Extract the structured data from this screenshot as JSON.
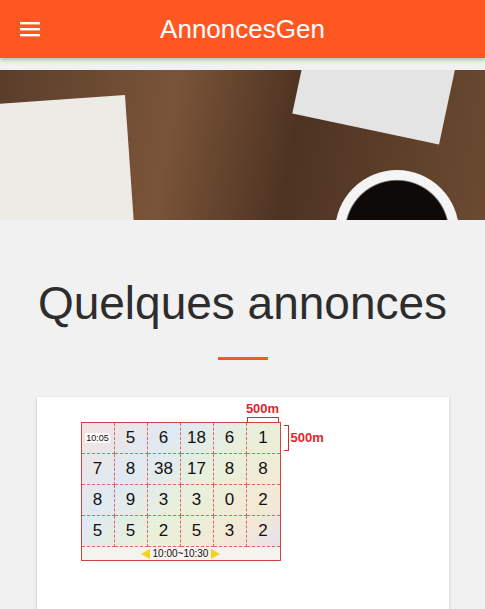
{
  "app_bar": {
    "title": "AnnoncesGen"
  },
  "section": {
    "title": "Quelques annonces"
  },
  "cards": [
    {
      "image": {
        "scale_top": "500m",
        "scale_side": "500m",
        "time": "10:05",
        "rows": [
          [
            "5",
            "6",
            "18",
            "6",
            "1"
          ],
          [
            "7",
            "8",
            "38",
            "17",
            "8",
            "8"
          ],
          [
            "8",
            "9",
            "3",
            "3",
            "0",
            "2"
          ],
          [
            "5",
            "5",
            "2",
            "5",
            "3",
            "2"
          ]
        ],
        "range": "10:00~10:30"
      }
    }
  ]
}
